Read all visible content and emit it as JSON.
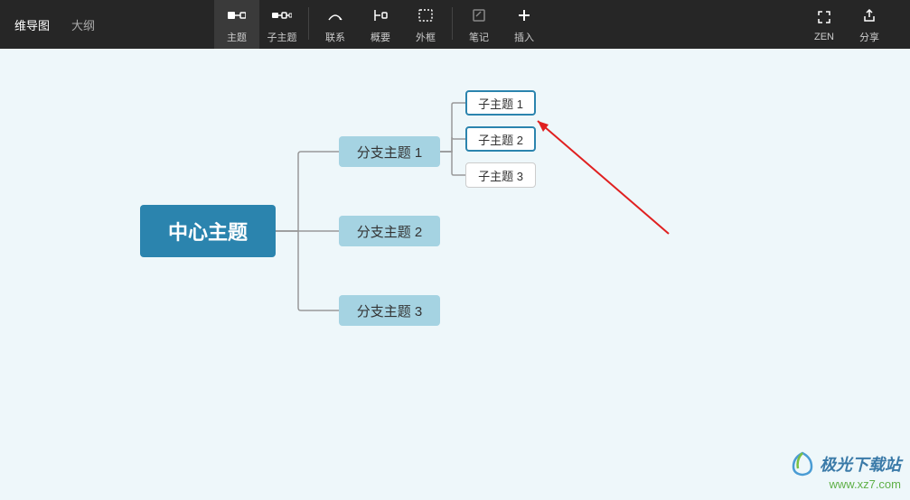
{
  "tabs": {
    "mindmap": "维导图",
    "outline": "大纲"
  },
  "toolbar": {
    "topic": "主题",
    "subtopic": "子主题",
    "relation": "联系",
    "summary": "概要",
    "boundary": "外框",
    "notes": "笔记",
    "insert": "插入",
    "zen": "ZEN",
    "share": "分享"
  },
  "mindmap": {
    "central": "中心主题",
    "branches": [
      {
        "label": "分支主题 1",
        "subs": [
          "子主题 1",
          "子主题 2",
          "子主题 3"
        ]
      },
      {
        "label": "分支主题 2",
        "subs": []
      },
      {
        "label": "分支主题 3",
        "subs": []
      }
    ]
  },
  "watermark": {
    "site_name": "极光下载站",
    "url": "www.xz7.com"
  },
  "colors": {
    "central_bg": "#2b84ae",
    "branch_bg": "#a5d3e2",
    "canvas_bg": "#eef7fa",
    "selected_border": "#2b84ae"
  }
}
